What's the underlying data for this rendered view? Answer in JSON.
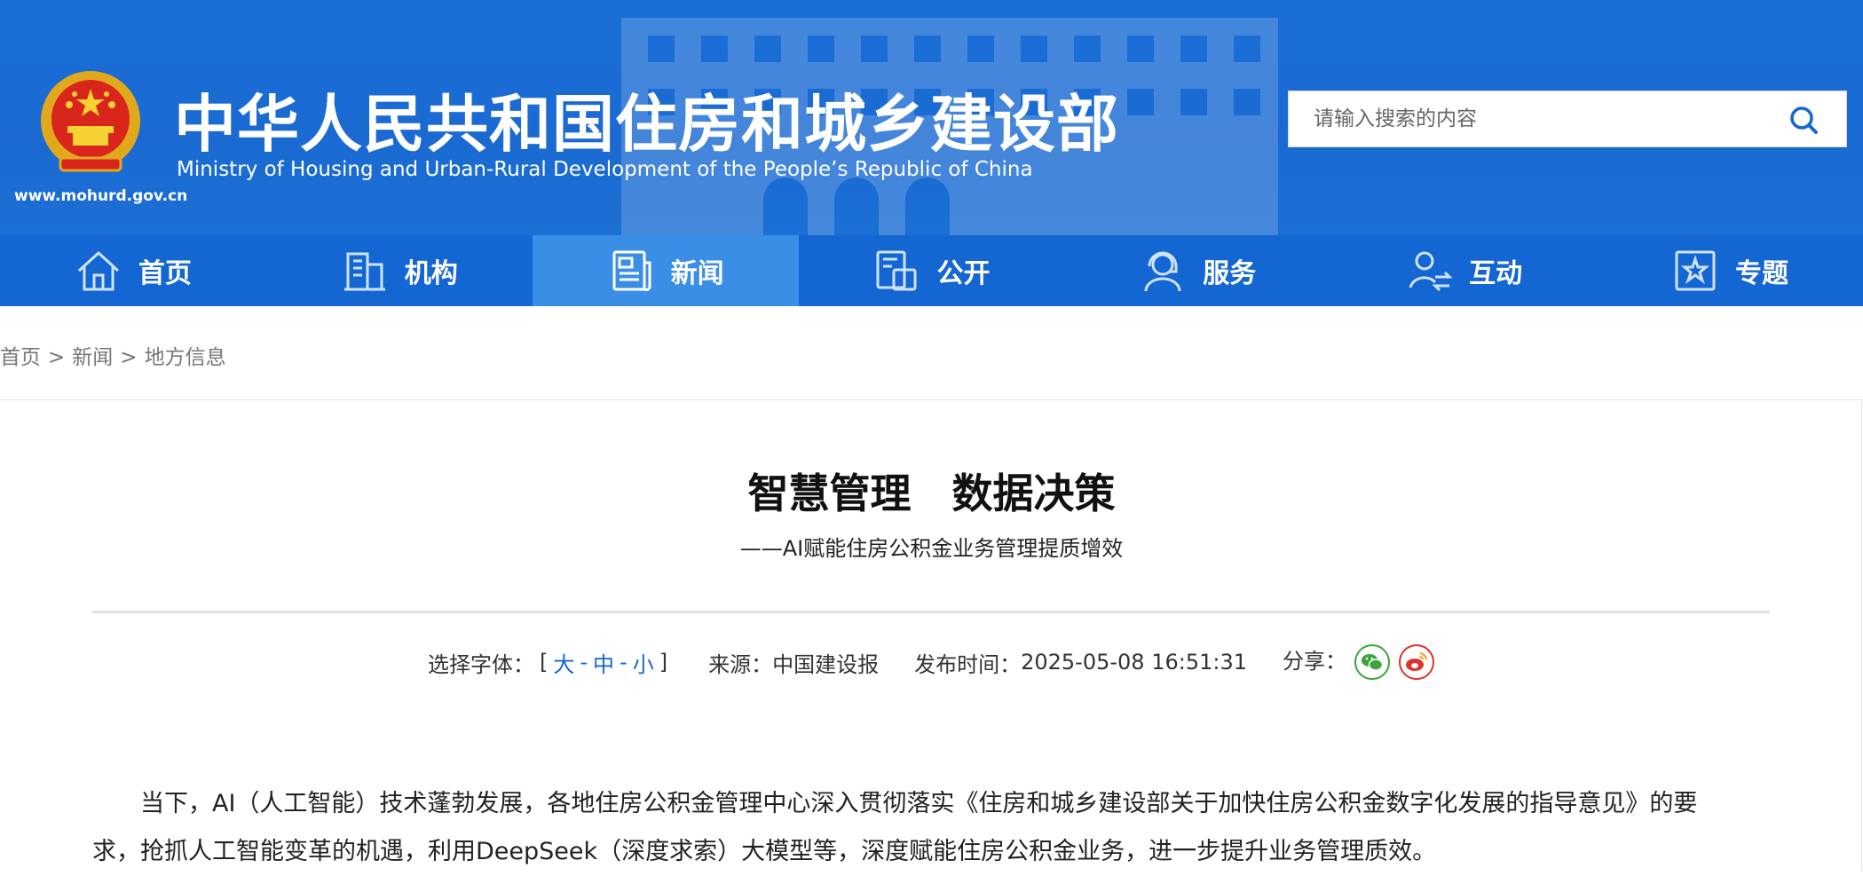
{
  "header": {
    "title_cn": "中华人民共和国住房和城乡建设部",
    "title_en": "Ministry of Housing and Urban-Rural Development of the People’s Republic of China",
    "site_url": "www.mohurd.gov.cn",
    "search_placeholder": "请输入搜索的内容",
    "colors": {
      "header_bg": "#1a6fd6",
      "nav_bg": "#1466d2",
      "nav_active": "#3a8ee6"
    }
  },
  "nav": {
    "items": [
      {
        "label": "首页",
        "icon": "home-icon"
      },
      {
        "label": "机构",
        "icon": "building-icon"
      },
      {
        "label": "新闻",
        "icon": "news-icon",
        "active": true
      },
      {
        "label": "公开",
        "icon": "disclosure-icon"
      },
      {
        "label": "服务",
        "icon": "service-icon"
      },
      {
        "label": "互动",
        "icon": "interaction-icon"
      },
      {
        "label": "专题",
        "icon": "topic-icon"
      }
    ]
  },
  "breadcrumb": {
    "home": "首页",
    "sep": ">",
    "news": "新闻",
    "current": "地方信息"
  },
  "article": {
    "title": "智慧管理　数据决策",
    "subtitle": "——AI赋能住房公积金业务管理提质增效",
    "meta": {
      "font_label": "选择字体：",
      "font_open": "[",
      "font_large": "大",
      "font_medium": "中",
      "font_small": "小",
      "font_close": "]",
      "dash": "-",
      "source_label": "来源：",
      "source": "中国建设报",
      "time_label": "发布时间：",
      "time": "2025-05-08 16:51:31",
      "share_label": "分享："
    },
    "para1_line1": "　　当下，AI（人工智能）技术蓬勃发展，各地住房公积金管理中心深入贯彻落实《住房和城乡建设部关于加快住房公积金数字化发展的指导意见》的要",
    "para1_line2": "求，抢抓人工智能变革的机遇，利用DeepSeek（深度求索）大模型等，深度赋能住房公积金业务，进一步提升业务管理质效。"
  }
}
